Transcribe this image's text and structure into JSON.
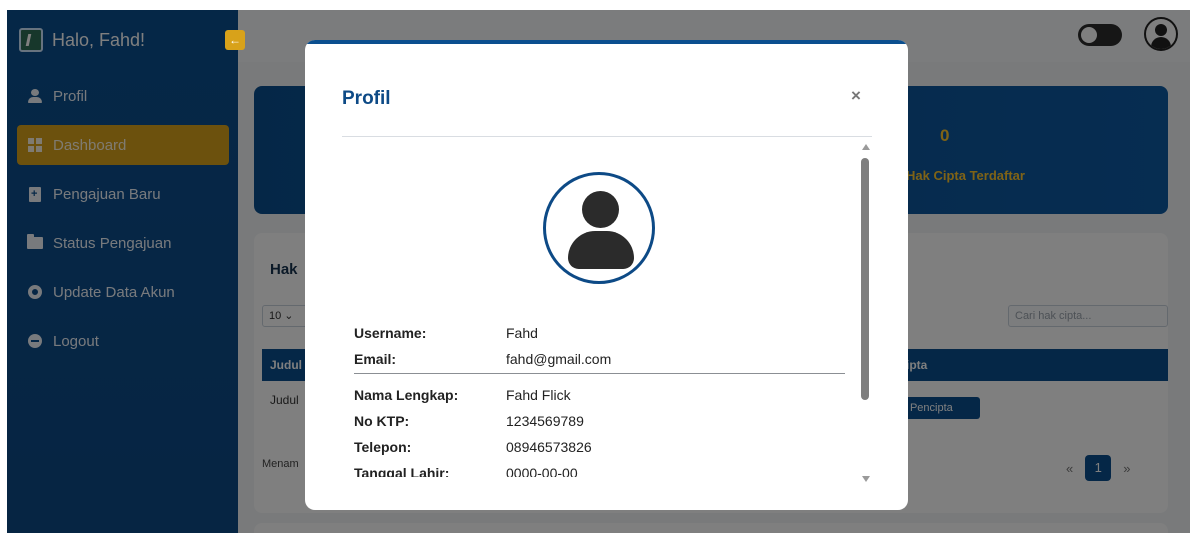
{
  "sidebar": {
    "title": "Halo, Fahd!",
    "items": [
      {
        "label": "Profil",
        "icon": "user-icon",
        "active": false
      },
      {
        "label": "Dashboard",
        "icon": "dashboard-icon",
        "active": true
      },
      {
        "label": "Pengajuan Baru",
        "icon": "file-plus-icon",
        "active": false
      },
      {
        "label": "Status Pengajuan",
        "icon": "folder-icon",
        "active": false
      },
      {
        "label": "Update Data Akun",
        "icon": "gear-icon",
        "active": false
      },
      {
        "label": "Logout",
        "icon": "logout-icon",
        "active": false
      }
    ]
  },
  "dashboard": {
    "stat_value": "0",
    "stat_label": "Hak Cipta Terdaftar",
    "table_title": "Hak",
    "page_length": "10",
    "search_placeholder": "Cari hak cipta...",
    "columns": [
      "Judul",
      "ipta"
    ],
    "row_title": "Judul",
    "row_button": "il Pencipta",
    "info_text": "Menam",
    "pagination": {
      "prev": "«",
      "current": "1",
      "next": "»"
    }
  },
  "modal": {
    "title": "Profil",
    "close": "×",
    "fields": [
      {
        "label": "Username:",
        "value": "Fahd"
      },
      {
        "label": "Email:",
        "value": "fahd@gmail.com"
      },
      {
        "label": "Nama Lengkap:",
        "value": "Fahd Flick"
      },
      {
        "label": "No KTP:",
        "value": "1234569789"
      },
      {
        "label": "Telepon:",
        "value": "08946573826"
      },
      {
        "label": "Tanggal Lahir:",
        "value": "0000-00-00"
      }
    ]
  },
  "colors": {
    "primary": "#0b4f8f",
    "accent": "#d8a21a",
    "stat_text": "#ffc72c"
  }
}
